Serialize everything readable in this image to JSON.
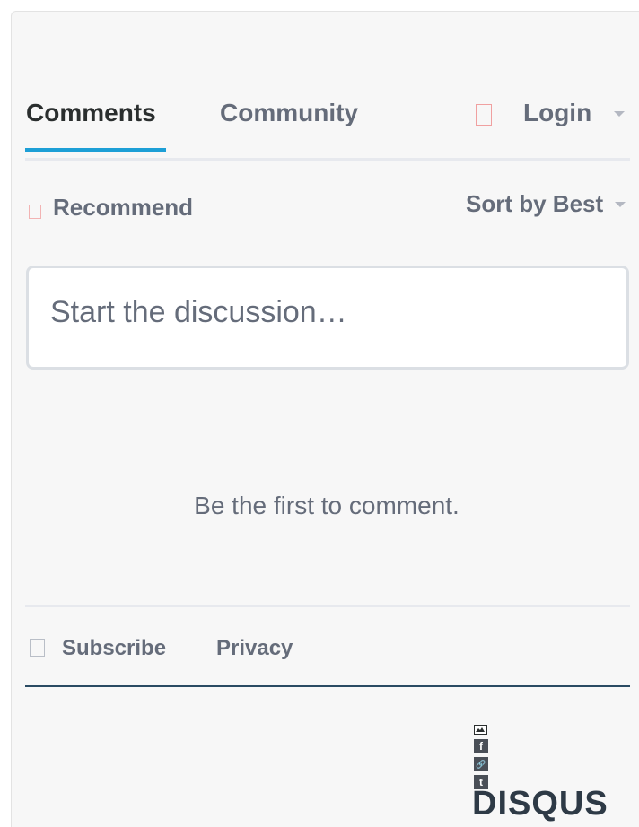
{
  "tabs": [
    {
      "label": "Comments",
      "active": true
    },
    {
      "label": "Community",
      "active": false
    }
  ],
  "login": {
    "label": "Login"
  },
  "toolbar": {
    "recommend_label": "Recommend",
    "sort_label": "Sort by Best"
  },
  "composer": {
    "placeholder": "Start the discussion…"
  },
  "empty_state": {
    "message": "Be the first to comment."
  },
  "footer": {
    "subscribe_label": "Subscribe",
    "privacy_label": "Privacy"
  },
  "share": {
    "facebook_glyph": "f",
    "link_glyph": "🔗",
    "twitter_glyph": "t"
  },
  "brand": {
    "logo_text": "DISQUS"
  },
  "colors": {
    "accent": "#1d9fd6",
    "text": "#656c7a",
    "text_dark": "#2a2e2e",
    "background": "#f7f7f7"
  }
}
